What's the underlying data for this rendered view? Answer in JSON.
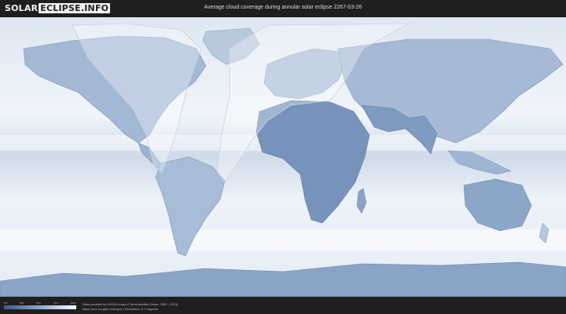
{
  "logo": {
    "part1": "SOLAR",
    "part2": "ECLIPSE.INFO"
  },
  "title": "Average cloud coverage during annular solar eclipse 2267-03-26",
  "legend": {
    "ticks": [
      "0%",
      "25%",
      "50%",
      "75%",
      "100%"
    ]
  },
  "credits": {
    "line1": "Data provided by NASA's Aqua & Terra satellite (Years: 2000 - 2019)",
    "line2": "https://neo.sci.gsfc.nasa.gov  |  Resolution: 0.1 degrees"
  },
  "colors": {
    "background": "#1f1f1f",
    "ocean_clear": "#e7eef7",
    "land_cloudfree": "#6f8fb9",
    "eclipse_path": "#ffffff"
  }
}
